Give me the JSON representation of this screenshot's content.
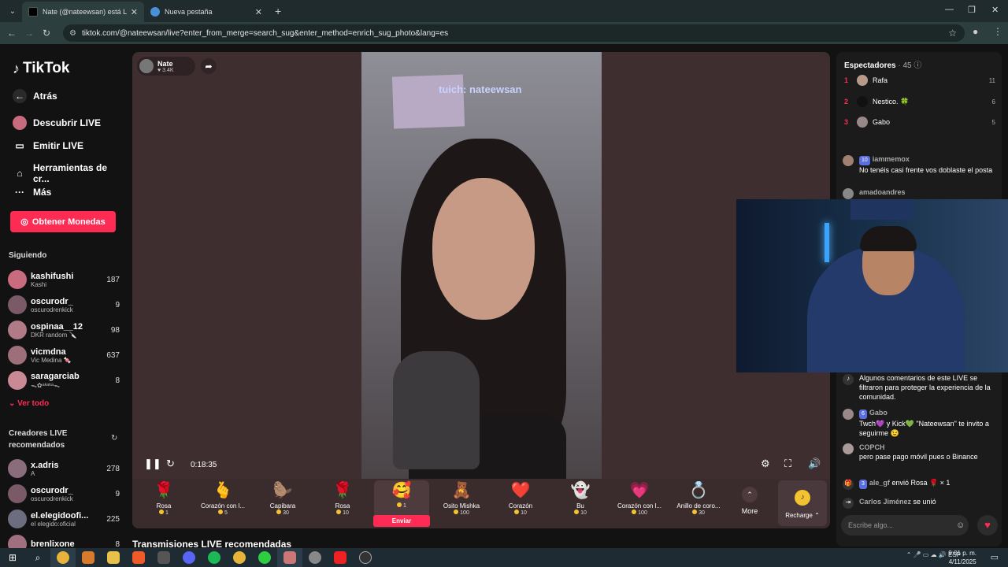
{
  "browser": {
    "tabs": [
      {
        "title": "Nate (@nateewsan) está LIVE",
        "active": true
      },
      {
        "title": "Nueva pestaña",
        "active": false
      }
    ],
    "url": "tiktok.com/@nateewsan/live?enter_from_merge=search_sug&enter_method=enrich_sug_photo&lang=es"
  },
  "sidebar": {
    "logo": "TikTok",
    "back": "Atrás",
    "nav": [
      "Descubrir LIVE",
      "Emitir LIVE",
      "Herramientas de cr...",
      "Más"
    ],
    "coins_button": "Obtener Monedas",
    "following_title": "Siguiendo",
    "following": [
      {
        "name": "kashifushi",
        "sub": "Kashi",
        "count": "187",
        "color": "#c86b7e"
      },
      {
        "name": "oscurodr_",
        "sub": "oscurodrenkick",
        "count": "9",
        "color": "#7a5a66"
      },
      {
        "name": "ospinaa__12",
        "sub": "DKR random 🔪",
        "count": "98",
        "color": "#b07b86"
      },
      {
        "name": "vicmdna",
        "sub": "Vic Medina 🍬",
        "count": "637",
        "color": "#9c6f7a"
      },
      {
        "name": "saragarciab",
        "sub": "ᯓ✿ᵃᵏᵃᵏᵃᯓ",
        "count": "8",
        "color": "#c98a96"
      }
    ],
    "see_all": "Ver todo",
    "recommended_title": "Creadores LIVE recomendados",
    "recommended": [
      {
        "name": "x.adris",
        "sub": "A",
        "count": "278",
        "color": "#8a6d7a"
      },
      {
        "name": "oscurodr_",
        "sub": "oscurodrenkick",
        "count": "9",
        "color": "#7a5a66"
      },
      {
        "name": "el.elegidoofi...",
        "sub": "el elegido:oficial",
        "count": "225",
        "color": "#6d6d80"
      },
      {
        "name": "brenlixone",
        "sub": "",
        "count": "8",
        "color": "#a07080"
      }
    ]
  },
  "player": {
    "host_name": "Nate",
    "host_likes": "3.4K",
    "watermark": "tuich: nateewsan",
    "elapsed": "0:18:35",
    "gifts": [
      {
        "icon": "🌹",
        "name": "Rosa",
        "price": "1"
      },
      {
        "icon": "🫰",
        "name": "Corazón con l...",
        "price": "5"
      },
      {
        "icon": "🦫",
        "name": "Capibara",
        "price": "30"
      },
      {
        "icon": "🌹",
        "name": "Rosa",
        "price": "10"
      },
      {
        "icon": "🥰",
        "name": "",
        "price": "1"
      },
      {
        "icon": "🧸",
        "name": "Osito Mishka",
        "price": "100"
      },
      {
        "icon": "❤️",
        "name": "Corazón",
        "price": "10"
      },
      {
        "icon": "👻",
        "name": "Bu",
        "price": "10"
      },
      {
        "icon": "💗",
        "name": "Corazón con l...",
        "price": "100"
      },
      {
        "icon": "💍",
        "name": "Anillo de coro...",
        "price": "30"
      }
    ],
    "send_label": "Enviar",
    "more_label": "More",
    "recharge_label": "Recharge"
  },
  "recommended_streams_title": "Transmisiones LIVE recomendadas",
  "chat": {
    "viewers_title": "Espectadores",
    "viewers_count": "· 45",
    "top_viewers": [
      {
        "rank": "1",
        "name": "Rafa",
        "score": "11",
        "color": "#b89a8a"
      },
      {
        "rank": "2",
        "name": "Nestico. 🍀",
        "score": "6",
        "color": "#111111"
      },
      {
        "rank": "3",
        "name": "Gabo",
        "score": "5",
        "color": "#998888"
      }
    ],
    "messages": [
      {
        "level": "10",
        "user": "iammemox",
        "text": "No tenéis casi frente vos doblaste el posta",
        "color": "#a08070"
      },
      {
        "level": "",
        "user": "amadoandres",
        "text": "",
        "color": "#888888"
      },
      {
        "level": "",
        "user": "",
        "text": "Algunos comentarios de este LIVE se filtraron para proteger la experiencia de la comunidad.",
        "color": "#333333"
      },
      {
        "level": "6",
        "user": "Gabo",
        "text": "Twch💜 y Kick💚 \"Nateewsan\" te invito a seguirme 😉",
        "color": "#998888"
      },
      {
        "level": "",
        "user": "COPCH",
        "text": "pero pase pago móvil pues o Binance",
        "color": "#aa9999"
      },
      {
        "level": "3",
        "user": "ale_gf",
        "text": "envió Rosa 🌹 × 1",
        "color": "#333333"
      },
      {
        "level": "",
        "user": "Carlos Jiménez",
        "text": "se unió",
        "color": "#333333"
      }
    ],
    "input_placeholder": "Escribe algo..."
  },
  "taskbar": {
    "time": "9:01 p. m.",
    "date": "4/11/2025",
    "lang": "ESP"
  }
}
